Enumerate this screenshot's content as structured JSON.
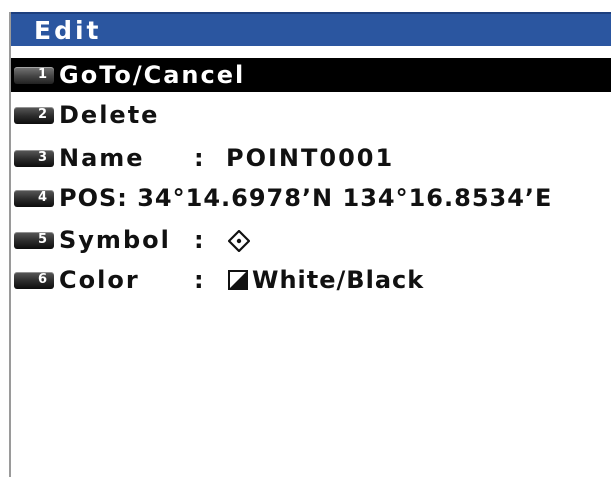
{
  "window": {
    "title": "Edit"
  },
  "menu": {
    "items": [
      {
        "key": "1",
        "label": "GoTo/Cancel",
        "selected": true
      },
      {
        "key": "2",
        "label": "Delete"
      },
      {
        "key": "3",
        "label": "Name",
        "colon": ":",
        "value": "POINT0001"
      },
      {
        "key": "4",
        "label": "POS: 34°14.6978’N 134°16.8534’E"
      },
      {
        "key": "5",
        "label": "Symbol",
        "colon": ":",
        "value_icon": "waypoint-diamond-icon"
      },
      {
        "key": "6",
        "label": "Color",
        "colon": ":",
        "value_icon": "white-black-swatch-icon",
        "value": "White/Black"
      }
    ]
  },
  "colors": {
    "title_bar": "#2b56a0",
    "selected_row": "#000000",
    "text": "#111111",
    "selected_text": "#ffffff"
  }
}
